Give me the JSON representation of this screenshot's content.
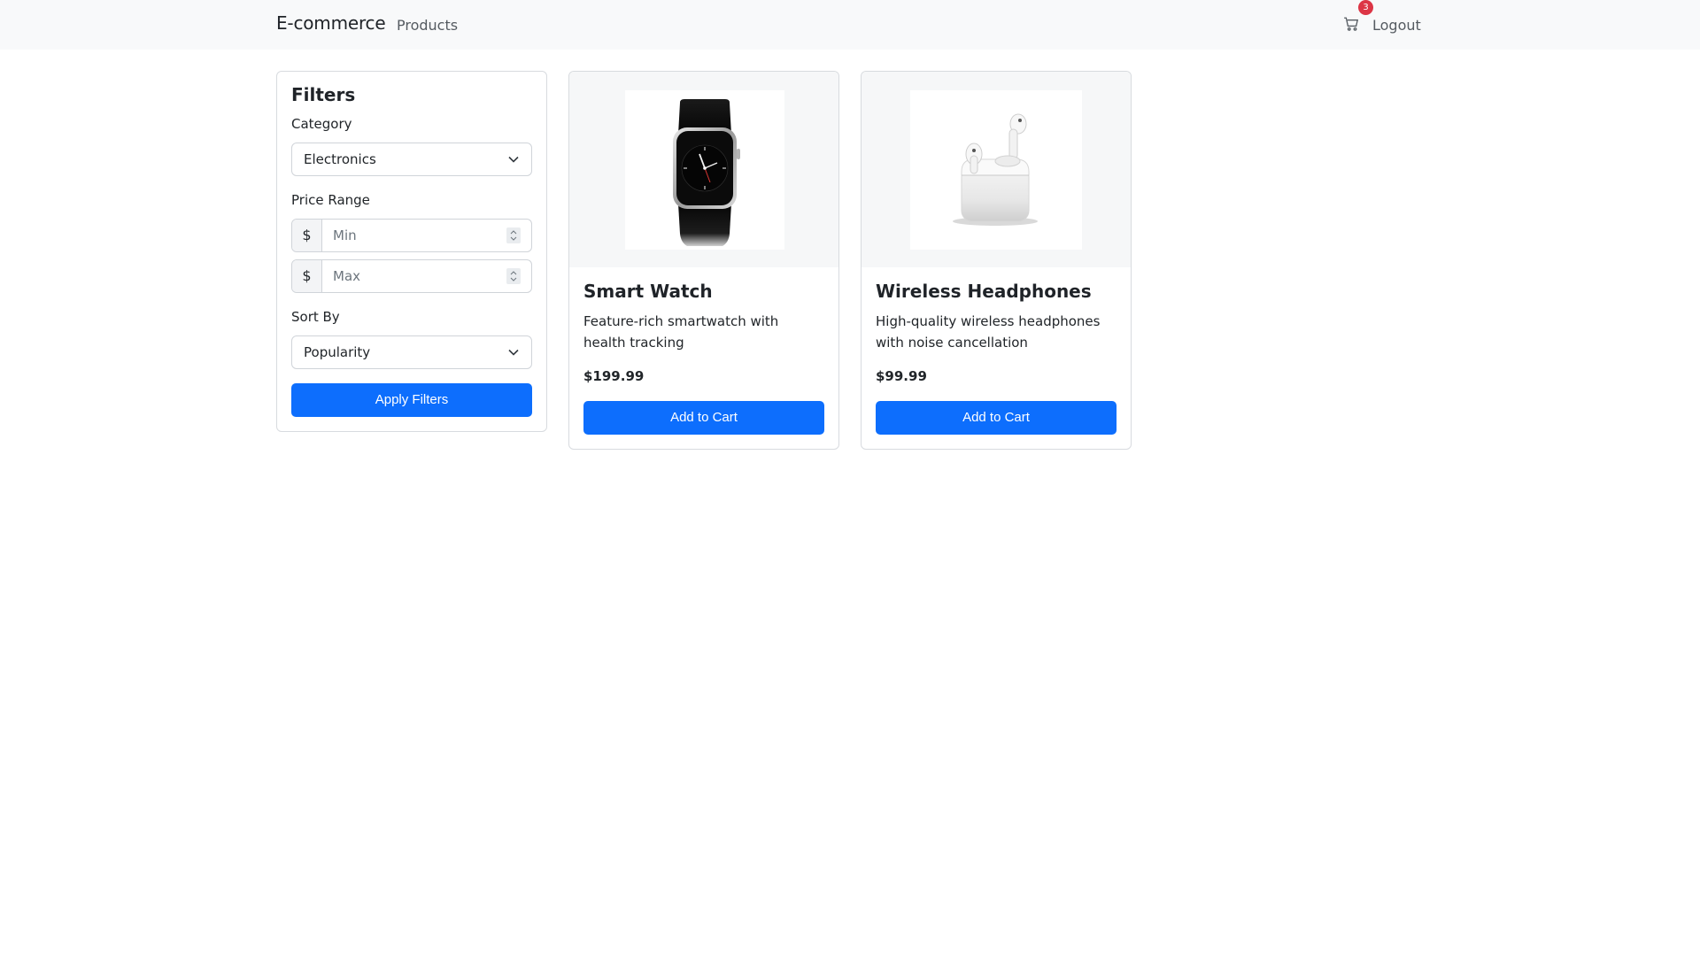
{
  "navbar": {
    "brand": "E-commerce",
    "nav_link": "Products",
    "cart_count": "3",
    "logout": "Logout"
  },
  "filters": {
    "title": "Filters",
    "category_label": "Category",
    "category_value": "Electronics",
    "price_label": "Price Range",
    "currency_symbol": "$",
    "min_placeholder": "Min",
    "max_placeholder": "Max",
    "sort_label": "Sort By",
    "sort_value": "Popularity",
    "apply_label": "Apply Filters"
  },
  "products": [
    {
      "name": "Smart Watch",
      "description": "Feature-rich smartwatch with health tracking",
      "price": "$199.99",
      "button": "Add to Cart",
      "icon": "smartwatch-image"
    },
    {
      "name": "Wireless Headphones",
      "description": "High-quality wireless headphones with noise cancellation",
      "price": "$99.99",
      "button": "Add to Cart",
      "icon": "earbuds-image"
    }
  ],
  "colors": {
    "primary": "#0d6efd",
    "badge": "#dc3545",
    "navbar_bg": "#f8f9fa"
  }
}
